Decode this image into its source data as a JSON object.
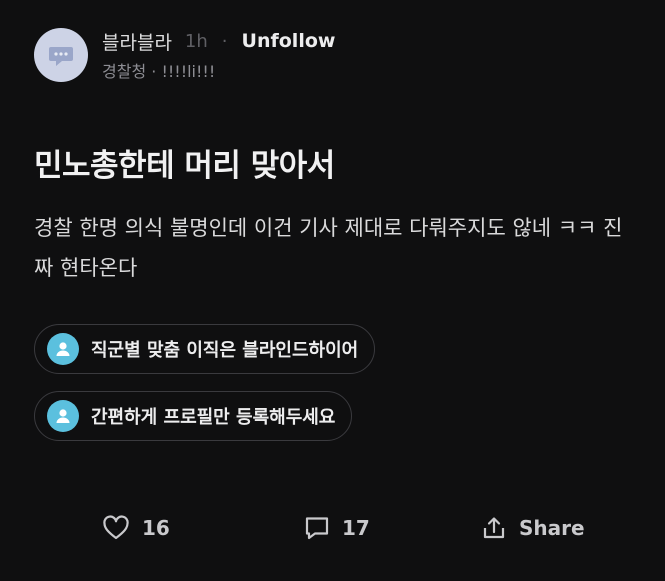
{
  "post": {
    "author": "블라블라",
    "time": "1h",
    "separator": "·",
    "unfollow_label": "Unfollow",
    "company": "경찰청",
    "company_separator": "·",
    "company_tag": "!!!!li!!!",
    "title": "민노총한테 머리 맞아서",
    "body": "경찰 한명 의식 불명인데 이건 기사 제대로 다뤄주지도 않네 ㅋㅋ 진짜 현타온다"
  },
  "promos": [
    {
      "label": "직군별 맞춤 이직은 블라인드하이어",
      "icon": "user-icon"
    },
    {
      "label": "간편하게 프로필만 등록해두세요",
      "icon": "user-icon"
    }
  ],
  "actions": {
    "like_count": "16",
    "comment_count": "17",
    "share_label": "Share"
  },
  "colors": {
    "background": "#0f0f10",
    "avatar_bg": "#cdd3e6",
    "promo_icon_bg": "#5bc0de",
    "muted_text": "#8d8d93"
  }
}
